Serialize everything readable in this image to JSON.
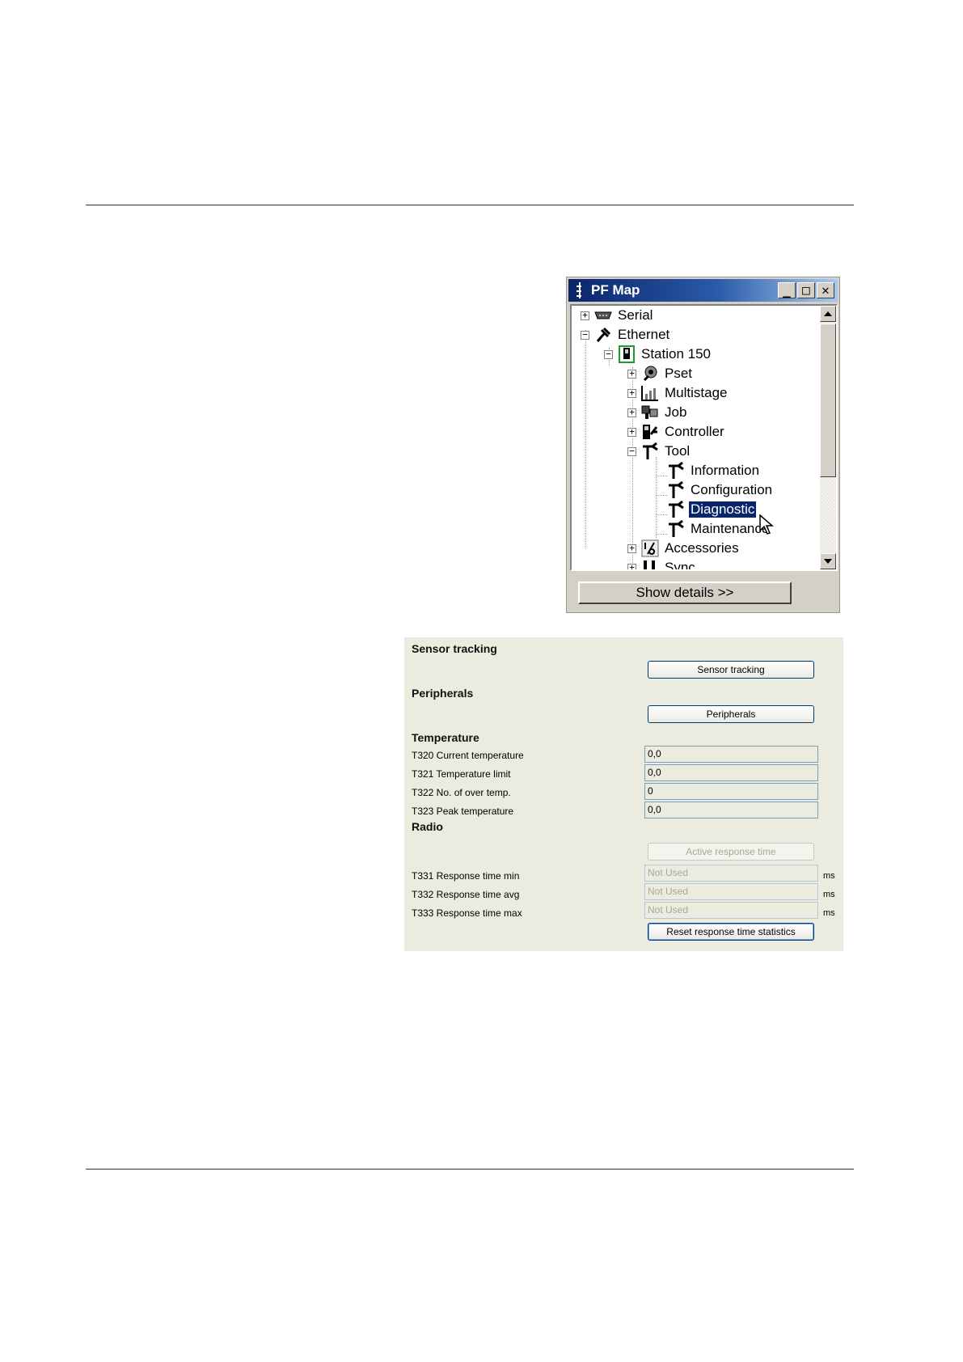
{
  "pf_map": {
    "title": "PF Map",
    "window_buttons": {
      "minimize": "_",
      "maximize": "□",
      "close": "✕"
    },
    "tree": [
      {
        "label": "Serial",
        "expander": "+",
        "icon": "serial-port-icon"
      },
      {
        "label": "Ethernet",
        "expander": "−",
        "icon": "ethernet-plug-icon"
      },
      {
        "label": "Station 150",
        "expander": "−",
        "icon": "station-icon"
      },
      {
        "label": "Pset",
        "expander": "+",
        "icon": "pset-icon"
      },
      {
        "label": "Multistage",
        "expander": "+",
        "icon": "multistage-icon"
      },
      {
        "label": "Job",
        "expander": "+",
        "icon": "job-icon"
      },
      {
        "label": "Controller",
        "expander": "+",
        "icon": "controller-icon"
      },
      {
        "label": "Tool",
        "expander": "−",
        "icon": "tool-icon"
      },
      {
        "label": "Information",
        "icon": "tool-icon"
      },
      {
        "label": "Configuration",
        "icon": "tool-icon"
      },
      {
        "label": "Diagnostic",
        "icon": "tool-icon",
        "selected": true
      },
      {
        "label": "Maintenance",
        "icon": "tool-icon"
      },
      {
        "label": "Accessories",
        "expander": "+",
        "icon": "accessories-icon"
      },
      {
        "label": "Sync",
        "expander": "+",
        "icon": "sync-icon"
      }
    ],
    "show_details_label": "Show details >>"
  },
  "diagnostic": {
    "sensor_tracking": {
      "title": "Sensor tracking",
      "button": "Sensor tracking"
    },
    "peripherals": {
      "title": "Peripherals",
      "button": "Peripherals"
    },
    "temperature": {
      "title": "Temperature",
      "fields": [
        {
          "label": "T320 Current temperature",
          "value": "0,0"
        },
        {
          "label": "T321 Temperature limit",
          "value": "0,0"
        },
        {
          "label": "T322 No. of over temp.",
          "value": "0"
        },
        {
          "label": "T323 Peak temperature",
          "value": "0,0"
        }
      ]
    },
    "radio": {
      "title": "Radio",
      "active_button": "Active response time",
      "fields": [
        {
          "label": "T331 Response time min",
          "value": "Not Used",
          "unit": "ms"
        },
        {
          "label": "T332 Response time avg",
          "value": "Not Used",
          "unit": "ms"
        },
        {
          "label": "T333 Response time max",
          "value": "Not Used",
          "unit": "ms"
        }
      ],
      "reset_button": "Reset response time statistics"
    }
  },
  "colors": {
    "titlebar_start": "#0a246a",
    "titlebar_end": "#a6caf0",
    "selection": "#0a246a",
    "panel_background": "#ecebe0",
    "window_face": "#d4d0c8"
  }
}
